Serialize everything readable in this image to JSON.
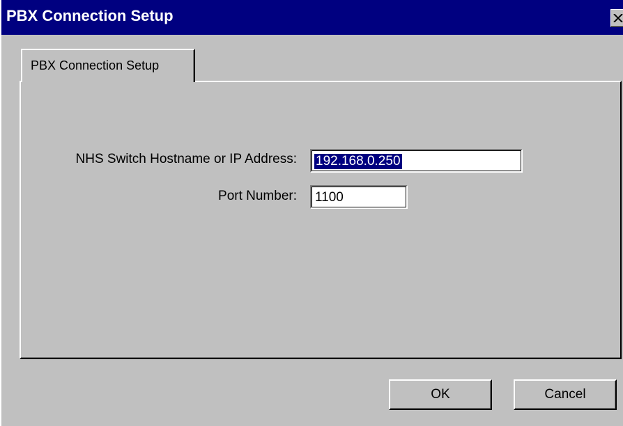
{
  "window": {
    "title": "PBX Connection Setup",
    "close_icon": "close-x"
  },
  "tabs": [
    {
      "label": "PBX Connection Setup",
      "active": true
    }
  ],
  "form": {
    "host_label": "NHS Switch Hostname or IP Address:",
    "host_value": "192.168.0.250",
    "host_selected": true,
    "port_label": "Port Number:",
    "port_value": "1100"
  },
  "buttons": {
    "ok_label": "OK",
    "cancel_label": "Cancel"
  },
  "colors": {
    "titlebar": "#000080",
    "face": "#c0c0c0",
    "selection": "#000080"
  }
}
